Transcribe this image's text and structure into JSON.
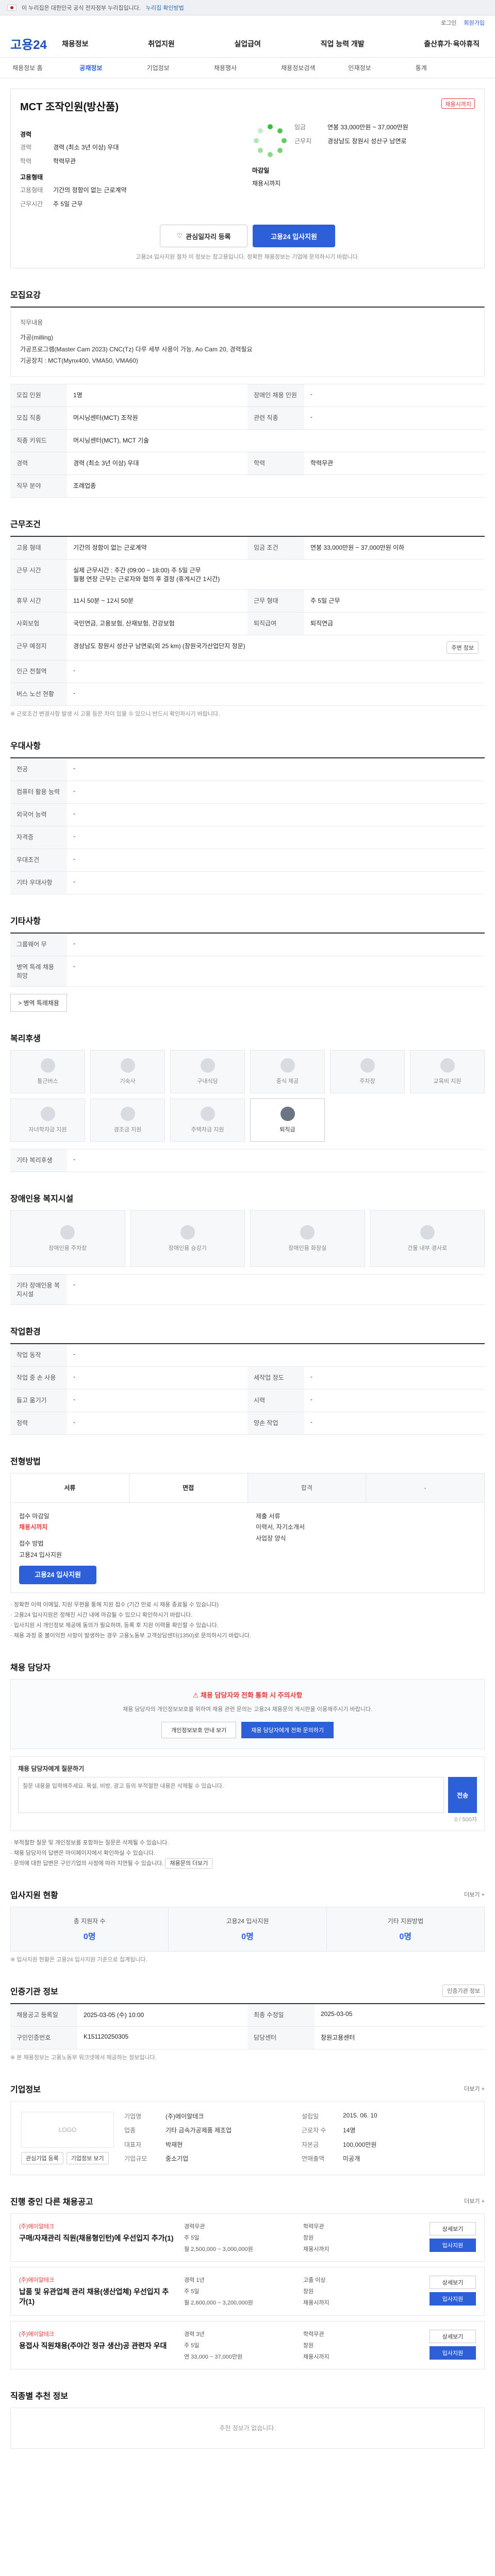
{
  "topbar": {
    "text": "이 누리집은 대한민국 공식 전자정부 누리집입니다.",
    "more": "누리집 확인방법"
  },
  "util": {
    "login": "로그인",
    "join": "회원가입"
  },
  "gnb": {
    "logo": "고용24",
    "menu": [
      "채용정보",
      "취업지원",
      "실업급여",
      "직업 능력 개발",
      "출산휴가·육아휴직"
    ]
  },
  "lnb": [
    "채용정보 홈",
    "공채정보",
    "기업정보",
    "채용행사",
    "채용정보검색",
    "인재정보",
    "통계"
  ],
  "job": {
    "title": "MCT 조작인원(방산품)",
    "badge": "채용시까지",
    "labels": {
      "career": "경력",
      "edu": "학력",
      "pay": "임금",
      "location": "근무지",
      "type": "고용형태",
      "hours": "근무시간"
    },
    "career": "경력 (최소 3년 이상) 우대",
    "edu": "학력무관",
    "pay": "연봉 33,000만원 ~ 37,000만원",
    "location": "경상남도 창원시 성산구 남면로",
    "type": "기간의 정함이 없는 근로계약",
    "hours": "주 5일 근무",
    "deadline_label": "마감일",
    "deadline": "채용시까지",
    "apply_method_label": "접수방법",
    "apply_method": "고용24 입사지원",
    "scrap": "관심일자리 등록",
    "apply": "고용24 입사지원",
    "notice": "고용24 입사지원 절차 이 정보는 참고용입니다. 정확한 채용정보는 기업에 문의하시기 바랍니다."
  },
  "sec_recruit": {
    "title": "모집요강",
    "job_desc_label": "직무내용",
    "job_desc": [
      "가공(milling)",
      "가공프로그램(Master Cam 2023) CNC(Tz) 다루 세부 사용이 가능, Ao Cam 20, 경력필요",
      "기공장치 : MCT(Mynx400, VMA50, VMA60)"
    ],
    "rows": [
      {
        "k": "모집 인원",
        "v": "1명",
        "k2": "장애인 채용 인원",
        "v2": "-"
      },
      {
        "k": "모집 직종",
        "v": "머시닝센터(MCT) 조작원",
        "k2": "관련 직종",
        "v2": "-"
      },
      {
        "k": "직종 키워드",
        "v": "머시닝센터(MCT), MCT 기술",
        "k2": "",
        "v2": ""
      },
      {
        "k": "경력",
        "v": "경력 (최소 3년 이상) 우대",
        "k2": "학력",
        "v2": "학력무관"
      },
      {
        "k": "직무 분야",
        "v": "조례업종",
        "k2": "",
        "v2": ""
      }
    ]
  },
  "sec_cond": {
    "title": "근무조건",
    "rows": [
      {
        "k": "고용 형태",
        "v": "기간의 정함이 없는 근로계약",
        "k2": "임금 조건",
        "v2": "연봉 33,000만원 ~ 37,000만원 이하"
      },
      {
        "k": "근무 시간",
        "v": "실제 근무시간 : 주간 (09:00 ~ 18:00) 주 5일 근무"
      },
      {
        "k": "",
        "v": "월평 연장 근무는 근로자와 협의 후 결정 (휴게시간 1시간)"
      },
      {
        "k": "휴무 시간",
        "v": "11시 50분 ~ 12시 50분",
        "k2": "근무 형태",
        "v2": "주 5일 근무"
      },
      {
        "k": "사회보험",
        "v": "국민연금, 고용보험, 산재보험, 건강보험",
        "k2": "퇴직급여",
        "v2": "퇴직연금"
      },
      {
        "k": "근무 예정지",
        "v": "경상남도 창원시 성산구 남면로(외 25 km) (창원국가산업단지 정문)"
      },
      {
        "k": "인근 전철역",
        "v": "-"
      },
      {
        "k": "버스 노선 현황",
        "v": "-"
      }
    ],
    "nearby_btn": "주변 정보",
    "footnote": "※ 근로조건 변경사항 발생 시 고용 등은 차이 있을 수 있으니 반드시 확인하시기 바랍니다."
  },
  "sec_pref": {
    "title": "우대사항",
    "rows": [
      {
        "k": "전공",
        "v": "-"
      },
      {
        "k": "컴퓨터 활용 능력",
        "v": "-"
      },
      {
        "k": "외국어 능력",
        "v": "-"
      },
      {
        "k": "자격증",
        "v": "-"
      },
      {
        "k": "우대조건",
        "v": "-"
      },
      {
        "k": "기타 우대사항",
        "v": "-"
      }
    ]
  },
  "sec_etc": {
    "title": "기타사항",
    "rows": [
      {
        "k": "그룹웨어 무",
        "v": "-"
      },
      {
        "k": "병역 특례 채용 희망",
        "v": "-"
      }
    ],
    "link": "> 병역 특례채용"
  },
  "sec_welfare": {
    "title": "복리후생",
    "items": [
      {
        "label": "통근버스",
        "on": false
      },
      {
        "label": "기숙사",
        "on": false
      },
      {
        "label": "구내식당",
        "on": false
      },
      {
        "label": "중식 제공",
        "on": false
      },
      {
        "label": "주차장",
        "on": false
      },
      {
        "label": "교육비 지원",
        "on": false
      },
      {
        "label": "자녀학자금 지원",
        "on": false
      },
      {
        "label": "경조금 지원",
        "on": false
      },
      {
        "label": "주택자금 지원",
        "on": false
      },
      {
        "label": "퇴직금",
        "on": true
      }
    ],
    "other_label": "기타 복리후생",
    "other": "-"
  },
  "sec_disabled": {
    "title": "장애인용 복지시설",
    "items": [
      "장애인용 주차장",
      "장애인용 승강기",
      "장애인용 화장실",
      "건물 내부 경사로"
    ],
    "other_label": "기타 장애인용 복지시설",
    "other": "-"
  },
  "sec_env": {
    "title": "작업환경",
    "rows": [
      {
        "k": "작업 동작",
        "v": "-",
        "k2": "",
        "v2": ""
      },
      {
        "k": "작업 중 손 사용",
        "v": "-",
        "k2": "세작업 정도",
        "v2": "-"
      },
      {
        "k": "들고 옮기기",
        "v": "-",
        "k2": "시력",
        "v2": "-"
      },
      {
        "k": "청력",
        "v": "-",
        "k2": "양손 작업",
        "v2": "-"
      }
    ]
  },
  "sec_process": {
    "title": "전형방법",
    "steps": [
      "서류",
      "면접",
      "합격",
      "-"
    ],
    "apply_deadline_label": "접수 마감일",
    "apply_deadline": "채용시까지",
    "apply_label": "접수 방법",
    "apply_method": "고용24 입사지원",
    "docs_label": "제출 서류",
    "docs": "이력서, 자기소개서",
    "docs_format": "사업장 양식",
    "btn": "고용24 입사지원",
    "bullets": [
      "· 정확한 이력 이메일, 지원 우편을 통해 지원 접수 (기간 만료 시 채용 종료될 수 있습니다)",
      "· 고용24 입사지원은 정해진 시간 내에 마감될 수 있으니 확인하시기 바랍니다.",
      "· 입사지원 시 개인정보 제공에 동의가 필요하며, 등록 후 지원 이력을 확인할 수 있습니다.",
      "· 채용 과정 중 불이익한 사항이 발생하는 경우 고용노동부 고객상담센터(1350)로 문의하시기 바랍니다."
    ]
  },
  "sec_contact": {
    "title": "채용 담당자",
    "warn": "채용 담당자와 전화 통화 시 주의사항",
    "desc": "채용 담당자의 개인정보보호를 위하여 채용 관련 문의는 고용24 채용문의 게시판을 이용해주시기 바랍니다.",
    "btn1": "개인정보보호 안내 보기",
    "btn2": "채용 담당자에게 전화 문의하기",
    "qa_label": "채용 담당자에게 질문하기",
    "qa_placeholder": "질문 내용을 입력해주세요. 욕설, 비방, 광고 등의 부적절한 내용은 삭제될 수 있습니다.",
    "qa_count": "0 / 500자",
    "qa_send": "전송",
    "qa_notes": [
      "· 부적절한 질문 및 개인정보를 포함하는 질문은 삭제될 수 있습니다.",
      "· 채용 담당자의 답변은 마이페이지에서 확인하실 수 있습니다.",
      "· 문의에 대한 답변은 구인기업의 사정에 따라 지연될 수 있습니다."
    ],
    "qa_more": "채용문의 더보기"
  },
  "sec_status": {
    "title": "입사지원 현황",
    "more": "더보기 +",
    "items": [
      {
        "k": "총 지원자 수",
        "v": "0명"
      },
      {
        "k": "고용24 입사지원",
        "v": "0명"
      },
      {
        "k": "기타 지원방법",
        "v": "0명"
      }
    ],
    "footnote": "※ 입사지원 현황은 고용24 입사지원 기준으로 집계됩니다."
  },
  "sec_info": {
    "title": "인증기관 정보",
    "btn": "인증기관 정보",
    "rows": [
      {
        "k": "채용공고 등록일",
        "v": "2025-03-05 (수) 10:00",
        "k2": "최종 수정일",
        "v2": "2025-03-05"
      },
      {
        "k": "구인인증번호",
        "v": "K151120250305",
        "k2": "담당센터",
        "v2": "창원고용센터"
      },
      {
        "k": "",
        "v": "※ 본 채용정보는 고용노동부 워크넷에서 제공하는 정보입니다.",
        "k2": "",
        "v2": ""
      }
    ]
  },
  "sec_company": {
    "title": "기업정보",
    "more": "더보기 +",
    "logo": "LOGO",
    "rows": [
      {
        "k": "기업명",
        "v": "(주)에이알테크",
        "k2": "설립일",
        "v2": "2015. 06. 10"
      },
      {
        "k": "업종",
        "v": "기타 금속가공제품 제조업",
        "k2": "근로자 수",
        "v2": "14명"
      },
      {
        "k": "대표자",
        "v": "박재현",
        "k2": "자본금",
        "v2": "100,000만원"
      },
      {
        "k": "기업규모",
        "v": "중소기업",
        "k2": "연매출액",
        "v2": "미공개"
      }
    ],
    "btn1": "관심기업 등록",
    "btn2": "기업정보 보기"
  },
  "sec_related": {
    "title": "진행 중인 다른 채용공고",
    "more": "더보기 +",
    "items": [
      {
        "co": "(주)에이알테크",
        "tt": "구매/자재관리 직원(채용형인턴)에 우선입지 추가(1)",
        "a": "경력무관",
        "b": "학력무관",
        "c": "주 5일",
        "d": "창원",
        "e": "월 2,500,000 ~ 3,000,000원",
        "f": "채용시까지"
      },
      {
        "co": "(주)에이알테크",
        "tt": "납품 및 유관업체 관리 채용(생산업체) 우선입지 추가(1)",
        "a": "경력 1년",
        "b": "고졸 이상",
        "c": "주 5일",
        "d": "창원",
        "e": "월 2,600,000 ~ 3,200,000원",
        "f": "채용시까지"
      },
      {
        "co": "(주)에이알테크",
        "tt": "용접사 직원채용(주야간 정규 생산)공 관련자 우대",
        "a": "경력 3년",
        "b": "학력무관",
        "c": "주 5일",
        "d": "창원",
        "e": "연 33,000 ~ 37,000만원",
        "f": "채용시까지"
      }
    ],
    "apply": "입사지원",
    "view": "상세보기"
  },
  "sec_footer": {
    "title": "직종별 추천 정보",
    "empty": "추천 정보가 없습니다."
  }
}
